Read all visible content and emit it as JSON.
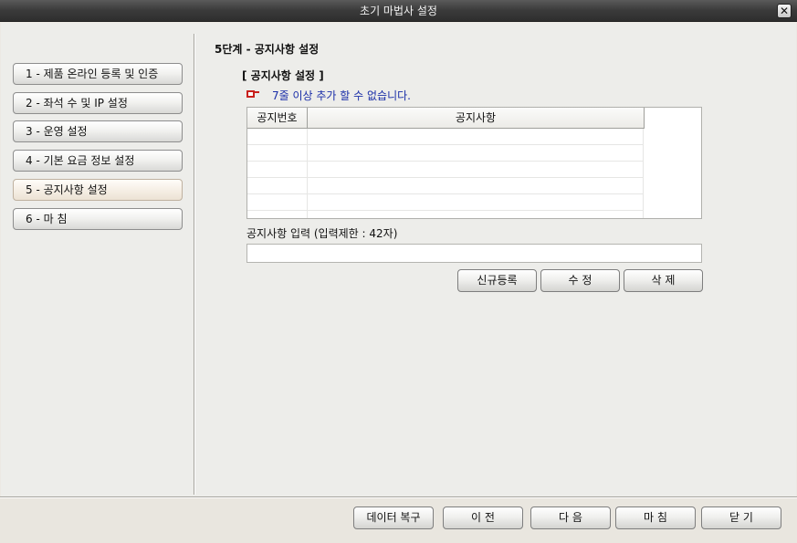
{
  "window": {
    "title": "초기 마법사 설정",
    "close_glyph": "✕"
  },
  "steps": [
    {
      "label": "1 - 제품 온라인 등록 및 인증",
      "active": false
    },
    {
      "label": "2 - 좌석 수 및 IP 설정",
      "active": false
    },
    {
      "label": "3 - 운영 설정",
      "active": false
    },
    {
      "label": "4 - 기본 요금 정보 설정",
      "active": false
    },
    {
      "label": "5 - 공지사항 설정",
      "active": true
    },
    {
      "label": "6 - 마 침",
      "active": false
    }
  ],
  "main": {
    "heading": "5단계 - 공지사항 설정",
    "subheading": "[ 공지사항 설정 ]",
    "warning": {
      "icon": "hand-pointer-icon",
      "text": "7줄 이상 추가 할 수 없습니다.",
      "color": "#1a2ea8"
    },
    "table": {
      "columns": [
        "공지번호",
        "공지사항"
      ],
      "rows": [
        [
          "",
          ""
        ],
        [
          "",
          ""
        ],
        [
          "",
          ""
        ],
        [
          "",
          ""
        ],
        [
          "",
          ""
        ]
      ]
    },
    "input": {
      "label": "공지사항 입력  (입력제한 : 42자)",
      "value": "",
      "placeholder": ""
    },
    "buttons": {
      "register": "신규등록",
      "edit": "수  정",
      "delete": "삭  제"
    }
  },
  "footer": {
    "restore": "데이터 복구",
    "prev": "이  전",
    "next": "다  음",
    "finish": "마  침",
    "close": "닫  기"
  }
}
